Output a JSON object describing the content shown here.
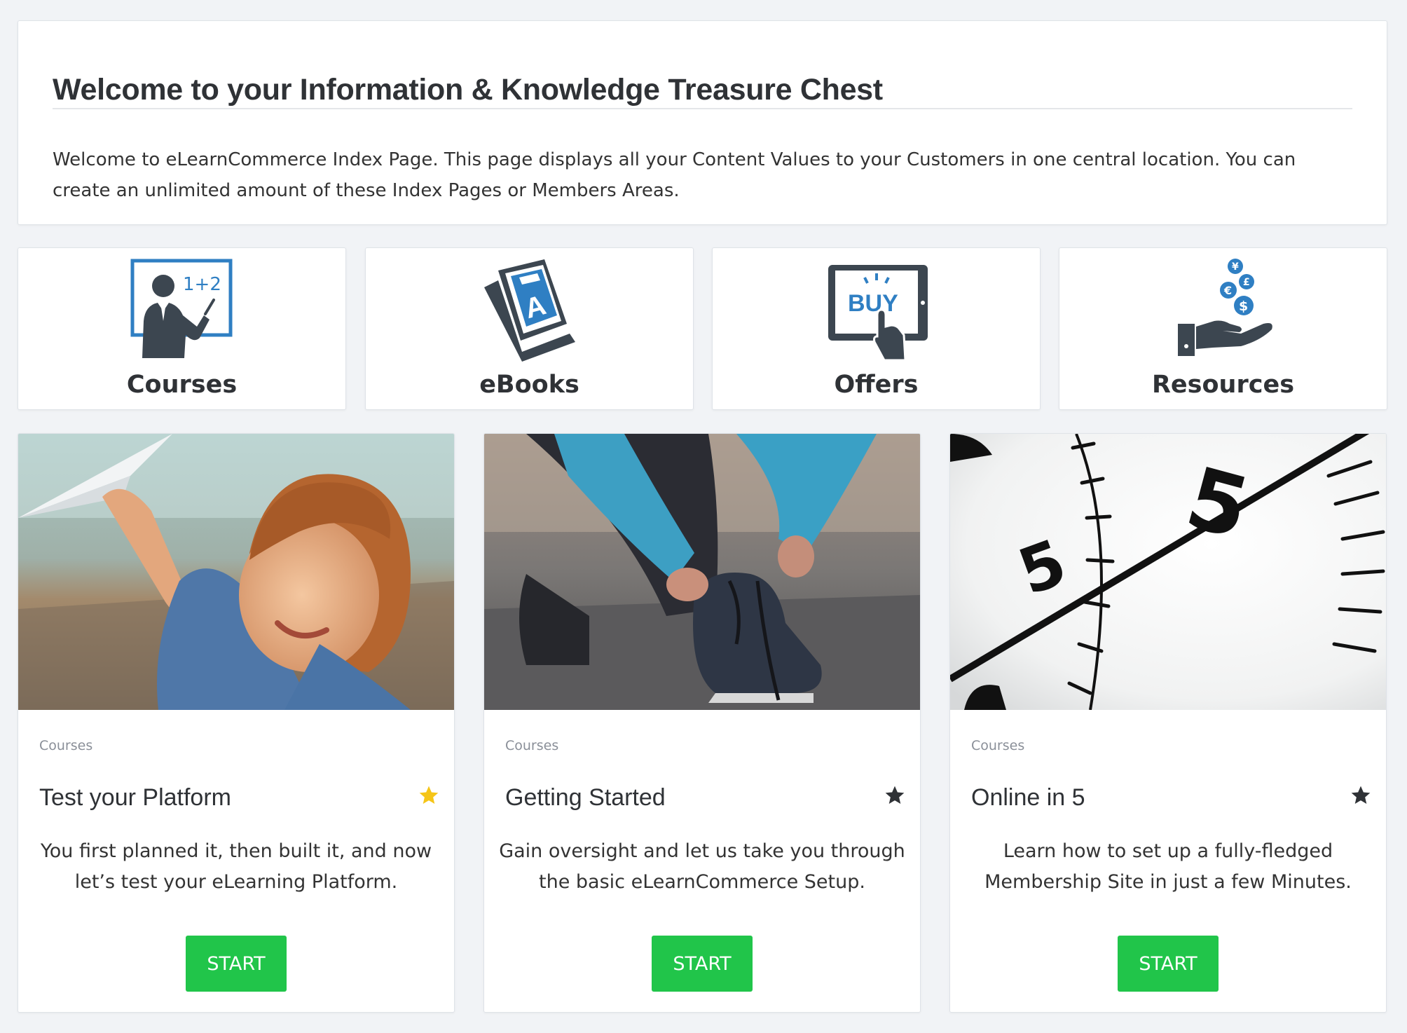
{
  "welcome": {
    "title": "Welcome to your Information & Knowledge Treasure Chest",
    "body": "Welcome to eLearnCommerce Index Page. This page displays all your Content Values to your Customers in one central location. You can create an unlimited amount of these Index Pages or Members Areas."
  },
  "categories": [
    {
      "label": "Courses",
      "icon": "teacher-icon"
    },
    {
      "label": "eBooks",
      "icon": "book-icon"
    },
    {
      "label": "Offers",
      "icon": "buy-tablet-icon"
    },
    {
      "label": "Resources",
      "icon": "money-hand-icon"
    }
  ],
  "icon_text": {
    "courses_board": "1+2",
    "ebooks_letter": "A",
    "offers_buy": "BUY",
    "currency": [
      "¥",
      "£",
      "€",
      "$"
    ]
  },
  "cards": [
    {
      "category": "Courses",
      "title": "Test your Platform",
      "description": "You first planned it, then built it, and now let’s test your eLearning Platform.",
      "button": "START",
      "favorited": true,
      "image": "girl-paper-plane-photo"
    },
    {
      "category": "Courses",
      "title": "Getting Started",
      "description": "Gain oversight and let us take you through the basic eLearnCommerce Setup.",
      "button": "START",
      "favorited": false,
      "image": "tying-shoelace-photo"
    },
    {
      "category": "Courses",
      "title": "Online in 5",
      "description": "Learn how to set up a fully-fledged Membership Site in just a few Minutes.",
      "button": "START",
      "favorited": false,
      "image": "stopwatch-photo"
    }
  ],
  "clock_digits": [
    "5",
    "5"
  ],
  "colors": {
    "accent_blue": "#2f7fc3",
    "icon_dark": "#3c4650",
    "button_green": "#21c54a",
    "star_active": "#f5c518",
    "star_inactive": "#2f3236"
  }
}
